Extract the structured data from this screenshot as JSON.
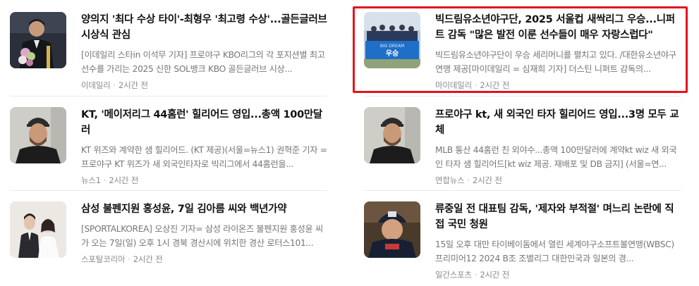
{
  "articles": [
    {
      "title": "양의지 '최다 수상 타이'-최형우 '최고령 수상'...골든글러브 시상식 관심",
      "summary": "[이데일리 스타in 이석무 기자] 프로야구 KBO리그의 각 포지션별 최고 선수를 가리는 2025 신한 SOL뱅크 KBO 골든글러브 시상...",
      "source": "이데일리",
      "time": "2시간 전",
      "thumb_icon": "award-ceremony-photo"
    },
    {
      "title": "빅드림유소년야구단, 2025 서울컵 새싹리그 우승...니퍼트 감독 \"많은 발전 이룬 선수들이 매우 자랑스럽다\"",
      "summary": "빅드림유소년야구단이 우승 세리머니를 펼치고 있다. /대한유소년야구연맹 제공[마이데일리 = 심재희 기자] 더스틴 니퍼트 감독의...",
      "source": "마이데일리",
      "time": "2시간 전",
      "thumb_icon": "team-banner-photo",
      "banner_text": "우승"
    },
    {
      "title": "KT, '메이저리그 44홈런' 힐리어드 영입...총액 100만달러",
      "summary": "KT 위즈와 계약한 샘 힐리어드. (KT 제공)(서울=뉴스1) 권혁준 기자 = 프로야구 KT 위즈가 새 외국인타자로 빅리그에서 44홈런을...",
      "source": "뉴스1",
      "time": "2시간 전",
      "thumb_icon": "player-portrait-photo"
    },
    {
      "title": "프로야구 kt, 새 외국인 타자 힐리어드 영입...3명 모두 교체",
      "summary": "MLB 통산 44홈런 친 외야수...총액 100만달러에 계약kt wiz 새 외국인 타자 샘 힐리어드[kt wiz 제공. 재배포 및 DB 금지] (서울=연...",
      "source": "연합뉴스",
      "time": "2시간 전",
      "thumb_icon": "player-portrait-photo"
    },
    {
      "title": "삼성 불펜지원 홍성윤, 7일 김아름 씨와 백년가약",
      "summary": "[SPORTALKOREA] 오상진 기자= 삼성 라이온즈 불펜지원 홍성윤 씨가 오는 7일(일) 오후 1시 경북 경산시에 위치한 경산 로터스101...",
      "source": "스포탈코리아",
      "time": "2시간 전",
      "thumb_icon": "wedding-couple-photo"
    },
    {
      "title": "류중일 전 대표팀 감독, '제자와 부적절' 며느리 논란에 직접 국민 청원",
      "summary": "15일 오후 대만 타이베이돔에서 열린 세계야구소프트볼연맹(WBSC) 프리미어12 2024 B조 조별리그 대한민국과 일본의 경...",
      "source": "일간스포츠",
      "time": "2시간 전",
      "thumb_icon": "coach-photo"
    }
  ]
}
